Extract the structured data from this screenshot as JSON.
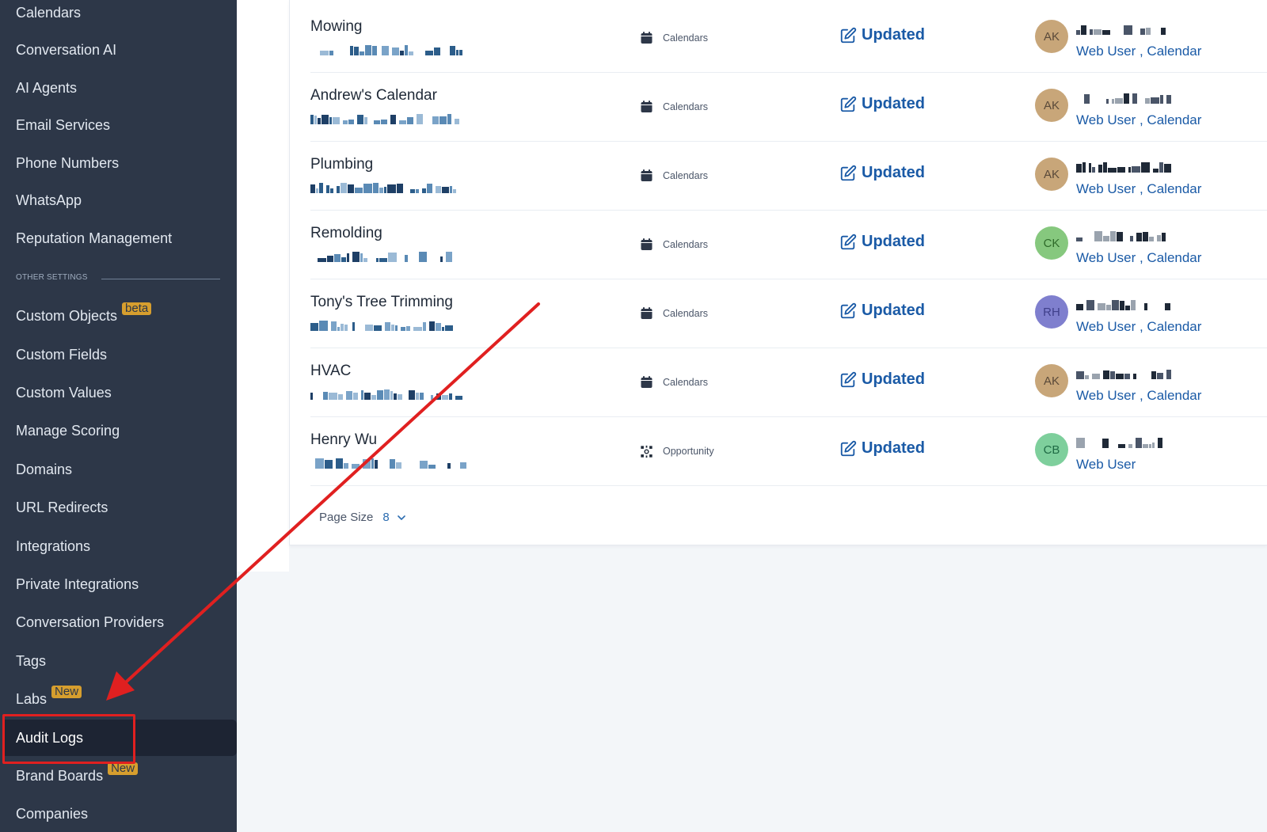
{
  "sidebar": {
    "items": [
      {
        "label": "Calendars",
        "badge": ""
      },
      {
        "label": "Conversation AI",
        "badge": ""
      },
      {
        "label": "AI Agents",
        "badge": ""
      },
      {
        "label": "Email Services",
        "badge": ""
      },
      {
        "label": "Phone Numbers",
        "badge": ""
      },
      {
        "label": "WhatsApp",
        "badge": ""
      },
      {
        "label": "Reputation Management",
        "badge": ""
      }
    ],
    "section_label": "OTHER SETTINGS",
    "other_items": [
      {
        "label": "Custom Objects",
        "badge": "beta"
      },
      {
        "label": "Custom Fields",
        "badge": ""
      },
      {
        "label": "Custom Values",
        "badge": ""
      },
      {
        "label": "Manage Scoring",
        "badge": ""
      },
      {
        "label": "Domains",
        "badge": ""
      },
      {
        "label": "URL Redirects",
        "badge": ""
      },
      {
        "label": "Integrations",
        "badge": ""
      },
      {
        "label": "Private Integrations",
        "badge": ""
      },
      {
        "label": "Conversation Providers",
        "badge": ""
      },
      {
        "label": "Tags",
        "badge": ""
      },
      {
        "label": "Labs",
        "badge": "New"
      },
      {
        "label": "Audit Logs",
        "badge": "",
        "active": true
      },
      {
        "label": "Brand Boards",
        "badge": "New"
      },
      {
        "label": "Companies",
        "badge": ""
      }
    ]
  },
  "logs": [
    {
      "name": "Mowing",
      "module": "Calendars",
      "module_icon": "calendar-icon",
      "action": "Updated",
      "avatar": "AK",
      "avatar_color": "#c8a679",
      "source": "Web User , Calendar"
    },
    {
      "name": "Andrew's Calendar",
      "module": "Calendars",
      "module_icon": "calendar-icon",
      "action": "Updated",
      "avatar": "AK",
      "avatar_color": "#c8a679",
      "source": "Web User , Calendar"
    },
    {
      "name": "Plumbing",
      "module": "Calendars",
      "module_icon": "calendar-icon",
      "action": "Updated",
      "avatar": "AK",
      "avatar_color": "#c8a679",
      "source": "Web User , Calendar"
    },
    {
      "name": "Remolding",
      "module": "Calendars",
      "module_icon": "calendar-icon",
      "action": "Updated",
      "avatar": "CK",
      "avatar_color": "#86c87e",
      "source": "Web User , Calendar"
    },
    {
      "name": "Tony's Tree Trimming",
      "module": "Calendars",
      "module_icon": "calendar-icon",
      "action": "Updated",
      "avatar": "RH",
      "avatar_color": "#7f7fce",
      "source": "Web User , Calendar"
    },
    {
      "name": "HVAC",
      "module": "Calendars",
      "module_icon": "calendar-icon",
      "action": "Updated",
      "avatar": "AK",
      "avatar_color": "#c8a679",
      "source": "Web User , Calendar"
    },
    {
      "name": "Henry Wu",
      "module": "Opportunity",
      "module_icon": "opportunity-icon",
      "action": "Updated",
      "avatar": "CB",
      "avatar_color": "#7ecf9c",
      "source": "Web User"
    }
  ],
  "pagination": {
    "label": "Page Size",
    "value": "8"
  },
  "colors": {
    "sidebar_bg": "#2d3748",
    "accent": "#1a5aa6",
    "annotation": "#e02020",
    "badge": "#d69e2e"
  }
}
